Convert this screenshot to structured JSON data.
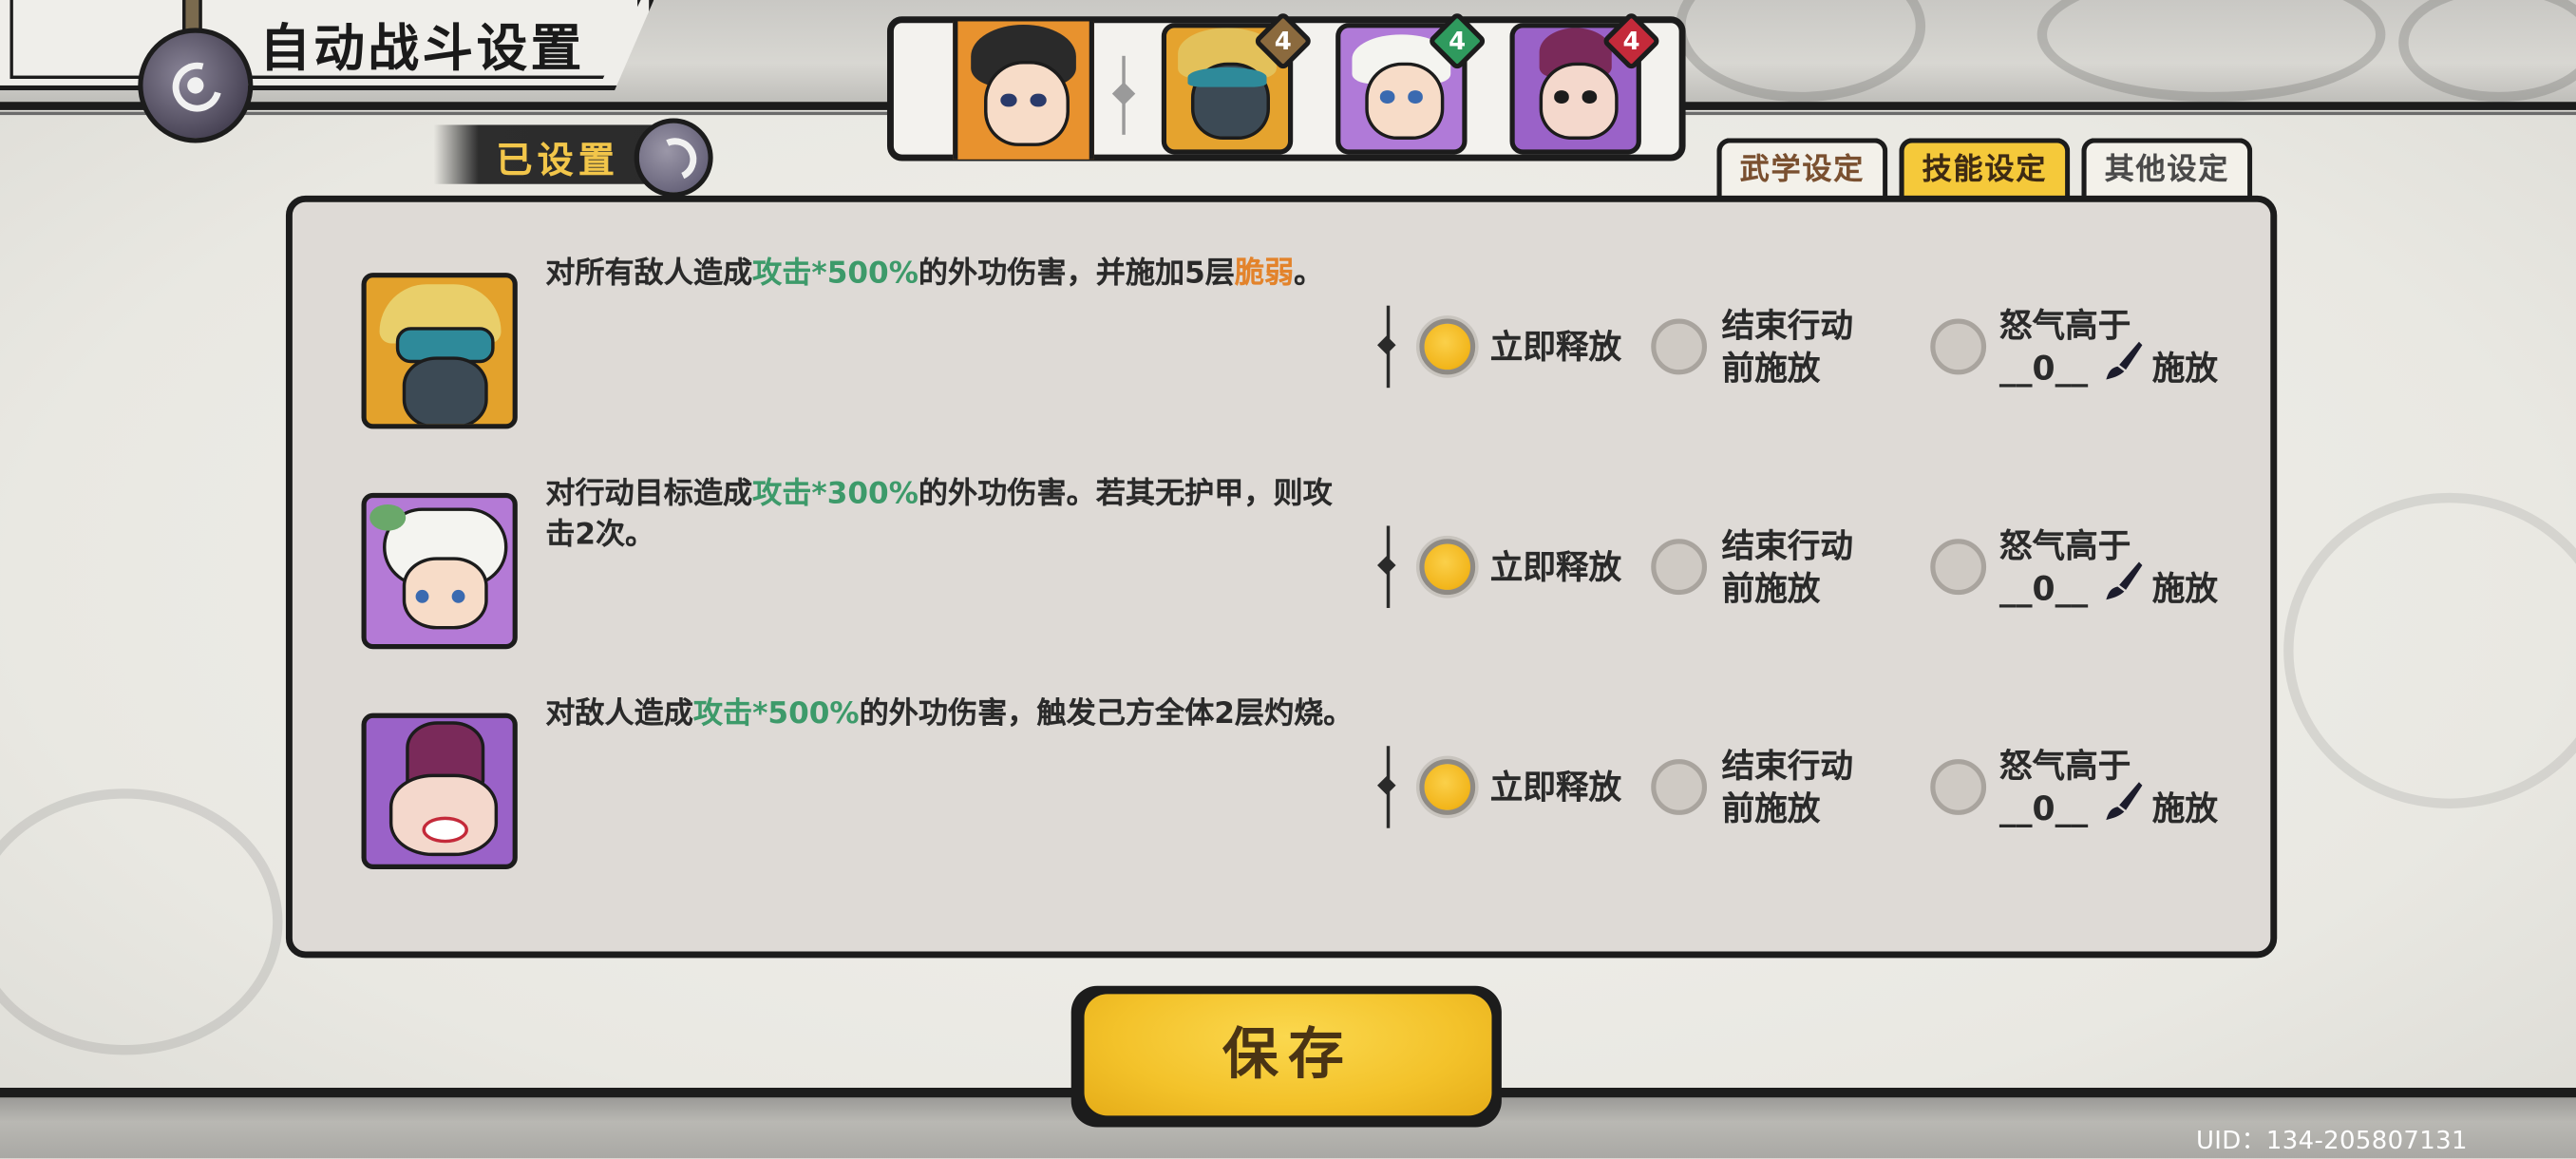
{
  "header": {
    "title": "自动战斗设置",
    "preset_status": "已设置"
  },
  "team": [
    {
      "name": "leader-portrait",
      "badge": ""
    },
    {
      "name": "member-1",
      "badge": "4",
      "badge_color": "#8b6a3e"
    },
    {
      "name": "member-2",
      "badge": "4",
      "badge_color": "#2f9a5e"
    },
    {
      "name": "member-3",
      "badge": "4",
      "badge_color": "#c42a3a"
    }
  ],
  "tabs": [
    {
      "label": "武学设定",
      "active": false
    },
    {
      "label": "技能设定",
      "active": true
    },
    {
      "label": "其他设定",
      "active": false
    }
  ],
  "skills": [
    {
      "desc_pre": "对所有敌人造成",
      "desc_hl": "攻击*500%",
      "desc_mid": "的外功伤害，并施加5层",
      "desc_or": "脆弱",
      "desc_post": "。",
      "opt_immediate": "立即释放",
      "opt_end_line1": "结束行动",
      "opt_end_line2": "前施放",
      "opt_rage_line1": "怒气高于",
      "rage_value": "__0__",
      "opt_rage_suffix": "施放",
      "selected": "immediate"
    },
    {
      "desc_pre": "对行动目标造成",
      "desc_hl": "攻击*300%",
      "desc_mid": "的外功伤害。若其无护甲，则攻击2次。",
      "desc_or": "",
      "desc_post": "",
      "opt_immediate": "立即释放",
      "opt_end_line1": "结束行动",
      "opt_end_line2": "前施放",
      "opt_rage_line1": "怒气高于",
      "rage_value": "__0__",
      "opt_rage_suffix": "施放",
      "selected": "immediate"
    },
    {
      "desc_pre": "对敌人造成",
      "desc_hl": "攻击*500%",
      "desc_mid": "的外功伤害，触发己方全体2层灼烧。",
      "desc_or": "",
      "desc_post": "",
      "opt_immediate": "立即释放",
      "opt_end_line1": "结束行动",
      "opt_end_line2": "前施放",
      "opt_rage_line1": "怒气高于",
      "rage_value": "__0__",
      "opt_rage_suffix": "施放",
      "selected": "immediate"
    }
  ],
  "save_label": "保存",
  "uid": "UID：134-205807131",
  "colors": {
    "accent": "#f5c93a",
    "highlight_green": "#3d9a6a",
    "highlight_orange": "#e3832b",
    "panel": "#dedad6"
  }
}
